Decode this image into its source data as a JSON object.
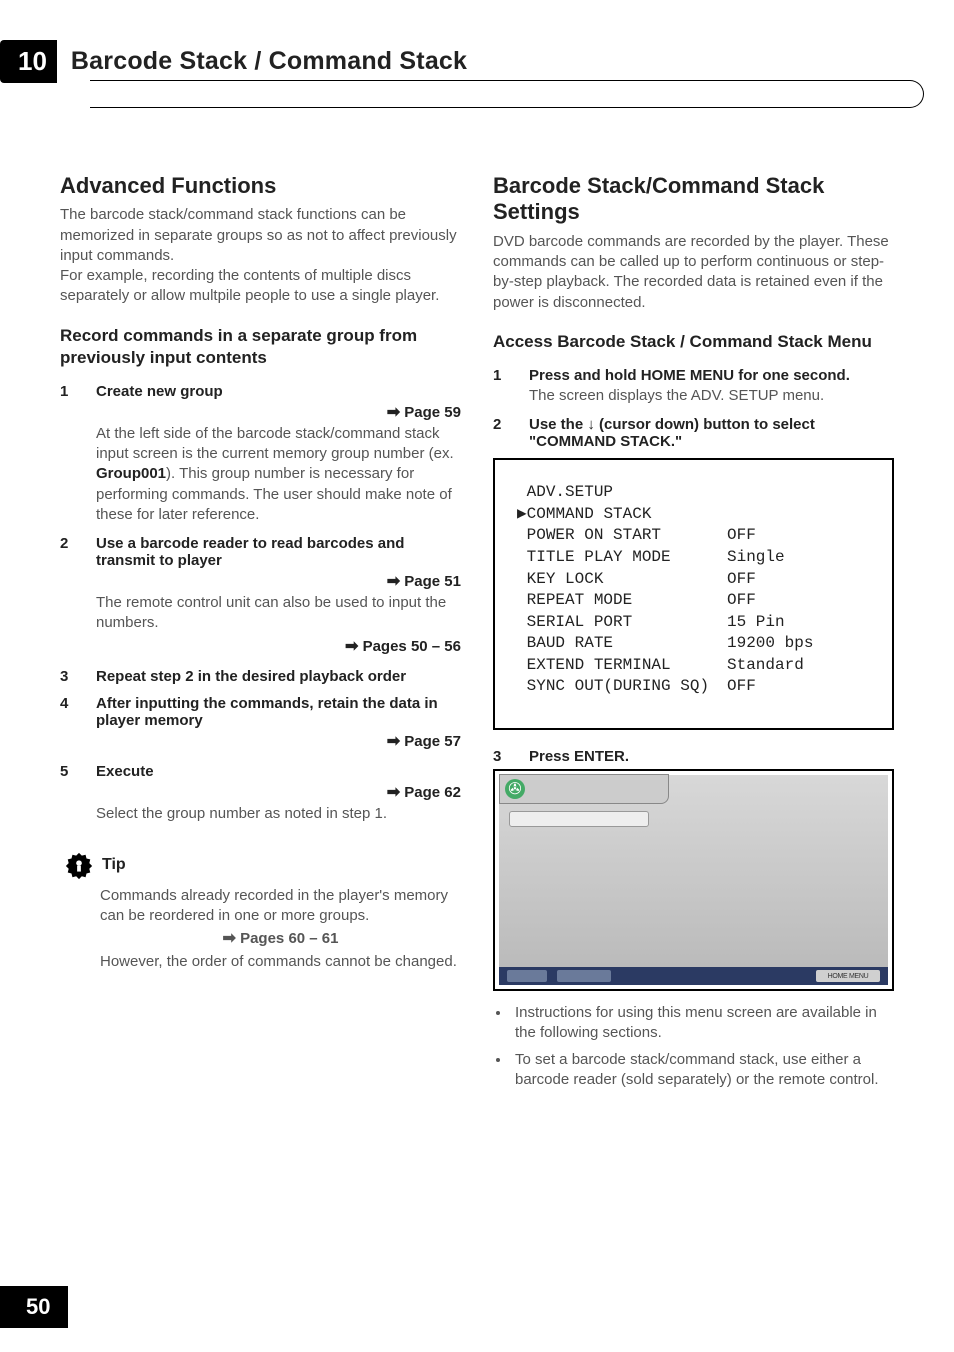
{
  "chapter_number": "10",
  "chapter_title": "Barcode Stack / Command Stack",
  "page_number": "50",
  "left": {
    "h2": "Advanced Functions",
    "intro": "The barcode stack/command stack functions can be memorized in separate groups so as not to affect previously input commands.\nFor example, recording the contents of multiple discs separately or allow multpile people to use a single player.",
    "h3": "Record commands in a separate group from previously input contents",
    "steps": [
      {
        "n": "1",
        "title": "Create new group",
        "ref": "Page 59",
        "body_pre": "At the left side of the barcode stack/command stack input screen is the current memory group number (ex. ",
        "body_strong": "Group001",
        "body_post": "). This group number is necessary for performing commands. The user should make note of these for later reference."
      },
      {
        "n": "2",
        "title": "Use a barcode reader to read barcodes and transmit to player",
        "ref": "Page 51",
        "body": "The remote control unit can also be used to input the numbers.",
        "ref2": "Pages 50 – 56"
      },
      {
        "n": "3",
        "title": "Repeat step 2 in the desired playback order"
      },
      {
        "n": "4",
        "title": "After inputting the commands, retain the data in player memory",
        "ref": "Page 57"
      },
      {
        "n": "5",
        "title": "Execute",
        "ref": "Page 62",
        "body": "Select the group number as noted in step 1."
      }
    ],
    "tip_label": "Tip",
    "tip_body1": "Commands already recorded in the player's memory can be reordered in one or more groups.",
    "tip_ref": "Pages 60 – 61",
    "tip_body2": "However, the order of commands cannot be changed."
  },
  "right": {
    "h2": "Barcode Stack/Command Stack Settings",
    "intro": "DVD barcode commands are recorded by the player. These commands can be called up to perform continuous or step-by-step playback. The recorded data is retained even if the power is disconnected.",
    "h3": "Access Barcode Stack / Command Stack Menu",
    "step1_n": "1",
    "step1_title": "Press and hold HOME MENU for one second.",
    "step1_body": "The screen displays the ADV. SETUP menu.",
    "step2_n": "2",
    "step2_pre": "Use the ",
    "step2_post": " (cursor down) button to select \"COMMAND STACK.\"",
    "adv": {
      "title": "ADV.SETUP",
      "cursor_row": "COMMAND STACK",
      "rows": [
        {
          "label": "POWER ON START",
          "val": "OFF"
        },
        {
          "label": "TITLE PLAY MODE",
          "val": "Single"
        },
        {
          "label": "KEY LOCK",
          "val": "OFF"
        },
        {
          "label": "REPEAT MODE",
          "val": "OFF"
        },
        {
          "label": "SERIAL PORT",
          "val": "15 Pin"
        },
        {
          "label": "BAUD RATE",
          "val": "19200 bps"
        },
        {
          "label": "EXTEND TERMINAL",
          "val": "Standard"
        },
        {
          "label": "SYNC OUT(DURING SQ)",
          "val": "OFF"
        }
      ]
    },
    "step3_n": "3",
    "step3_title": "Press ENTER.",
    "screen_bottom_right": "HOME MENU",
    "bullets": [
      "Instructions for using this menu screen are available in the following sections.",
      "To set a barcode stack/command stack, use either a barcode reader (sold separately) or the remote control."
    ]
  }
}
